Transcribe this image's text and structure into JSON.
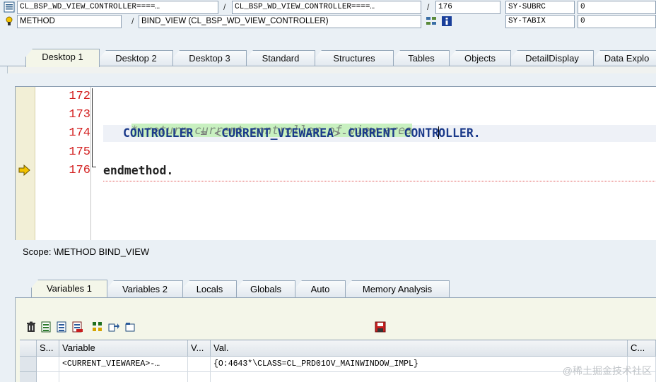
{
  "header": {
    "row1": {
      "program1": "CL_BSP_WD_VIEW_CONTROLLER====…",
      "sep1": "/",
      "program2": "CL_BSP_WD_VIEW_CONTROLLER====…",
      "sep2": "/",
      "line": "176",
      "sys_field_name": "SY-SUBRC",
      "sys_field_value": "0"
    },
    "row2": {
      "event_type": "METHOD",
      "sep": "/",
      "event_name": "BIND_VIEW (CL_BSP_WD_VIEW_CONTROLLER)",
      "sys_field_name": "SY-TABIX",
      "sys_field_value": "0"
    }
  },
  "desktop_tabs": [
    "Desktop 1",
    "Desktop 2",
    "Desktop 3",
    "Standard",
    "Structures",
    "Tables",
    "Objects",
    "DetailDisplay",
    "Data Explo"
  ],
  "editor": {
    "line_numbers": [
      "172",
      "173",
      "174",
      "175",
      "176"
    ],
    "comment_line": "* return current controller of view area",
    "code_a": "CONTROLLER",
    "code_eq": " = ",
    "code_lt": "<",
    "code_b": "CURRENT_VIEWAREA",
    "code_gt": ">",
    "code_dash1": "-",
    "code_c": "CURRENT",
    "code_dash2": "-",
    "code_d1": "CONTR",
    "code_d2": "OLLER",
    "code_dot": ".",
    "endmethod": "endmethod",
    "endmethod_dot": "."
  },
  "scope_text": "Scope: \\METHOD BIND_VIEW",
  "lower_tabs": [
    "Variables 1",
    "Variables 2",
    "Locals",
    "Globals",
    "Auto",
    "Memory Analysis"
  ],
  "variables_table": {
    "headers": [
      "S...",
      "Variable",
      "V...",
      "Val.",
      "C..."
    ],
    "rows": [
      {
        "variable": "<CURRENT_VIEWAREA>-…",
        "value": "{O:4643*\\CLASS=CL_PRD01OV_MAINWINDOW_IMPL}"
      }
    ]
  },
  "watermark": "@稀土掘金技术社区",
  "colors": {
    "line_number": "#d32020",
    "comment_bg": "#c8f0c0",
    "keyword": "#1b3a8a",
    "exec_arrow": "#d8a400"
  }
}
